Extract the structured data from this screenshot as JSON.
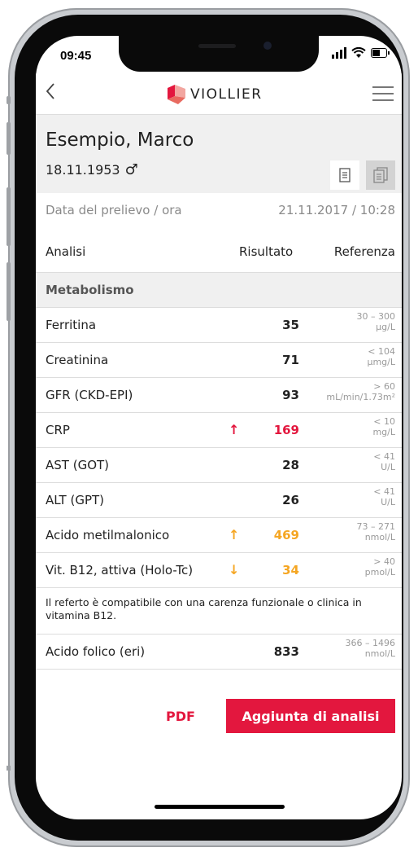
{
  "status_bar": {
    "time": "09:45"
  },
  "nav": {
    "back_icon": "chevron-left-icon",
    "logo_text": "VIOLLIER",
    "menu_icon": "hamburger-icon"
  },
  "patient": {
    "name": "Esempio, Marco",
    "dob": "18.11.1953",
    "gender_symbol": "♂"
  },
  "sample": {
    "label": "Data del prelievo / ora",
    "value": "21.11.2017 / 10:28"
  },
  "table": {
    "headers": {
      "analysis": "Analisi",
      "result": "Risultato",
      "reference": "Referenza"
    },
    "section": "Metabolismo",
    "rows": [
      {
        "name": "Ferritina",
        "arrow": "",
        "value": "35",
        "ref_range": "30 – 300",
        "ref_unit": "µg/L",
        "status": "normal"
      },
      {
        "name": "Creatinina",
        "arrow": "",
        "value": "71",
        "ref_range": "< 104",
        "ref_unit": "µmg/L",
        "status": "normal"
      },
      {
        "name": "GFR (CKD-EPI)",
        "arrow": "",
        "value": "93",
        "ref_range": "> 60",
        "ref_unit": "mL/min/1.73m²",
        "status": "normal"
      },
      {
        "name": "CRP",
        "arrow": "↑",
        "value": "169",
        "ref_range": "< 10",
        "ref_unit": "mg/L",
        "status": "high"
      },
      {
        "name": "AST (GOT)",
        "arrow": "",
        "value": "28",
        "ref_range": "< 41",
        "ref_unit": "U/L",
        "status": "normal"
      },
      {
        "name": "ALT (GPT)",
        "arrow": "",
        "value": "26",
        "ref_range": "< 41",
        "ref_unit": "U/L",
        "status": "normal"
      },
      {
        "name": "Acido metilmalonico",
        "arrow": "↑",
        "value": "469",
        "ref_range": "73 – 271",
        "ref_unit": "nmol/L",
        "status": "warn"
      },
      {
        "name": "Vit. B12, attiva (Holo-Tc)",
        "arrow": "↓",
        "value": "34",
        "ref_range": "> 40",
        "ref_unit": "pmol/L",
        "status": "warn"
      }
    ],
    "note": "Il referto è compatibile con una carenza funzionale o clinica in vitamina B12.",
    "last_row": {
      "name": "Acido folico (eri)",
      "arrow": "",
      "value": "833",
      "ref_range": "366 – 1496",
      "ref_unit": "nmol/L",
      "status": "normal"
    }
  },
  "actions": {
    "pdf_label": "PDF",
    "add_label": "Aggiunta di analisi"
  },
  "colors": {
    "accent": "#e3173e",
    "warn": "#f5a623",
    "high": "#e3173e",
    "normal": "#222222"
  }
}
